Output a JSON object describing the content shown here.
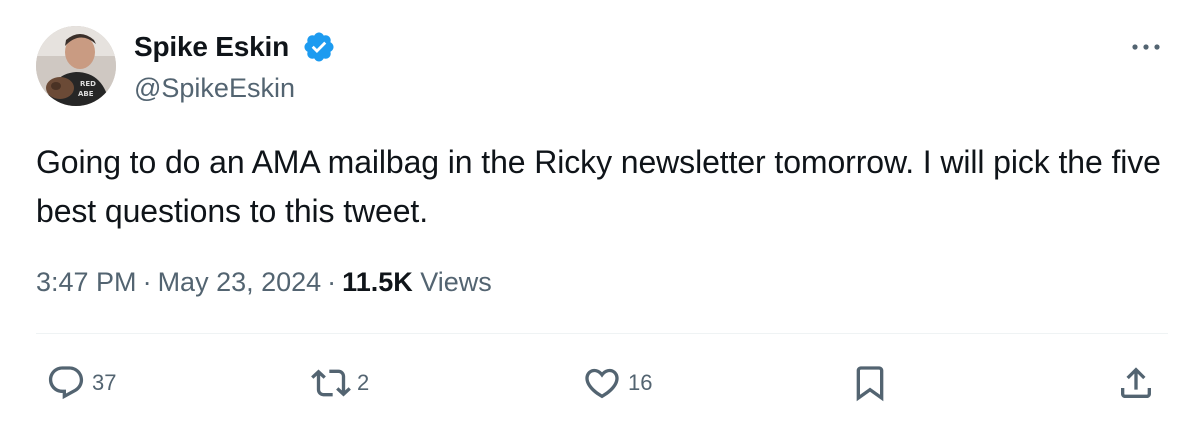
{
  "author": {
    "display_name": "Spike Eskin",
    "handle": "@SpikeEskin",
    "avatar_icon": "profile-photo",
    "verified_icon": "verified-badge-icon",
    "verified_color": "#1d9bf0"
  },
  "tweet": {
    "text": "Going to do an AMA mailbag in the Ricky newsletter tomorrow. I will pick the five best questions to this tweet.",
    "time": "3:47 PM",
    "separator": "·",
    "date": "May 23, 2024",
    "views_count": "11.5K",
    "views_label": "Views"
  },
  "actions": {
    "reply_count": "37",
    "retweet_count": "2",
    "like_count": "16"
  },
  "colors": {
    "text_primary": "#0f1419",
    "text_secondary": "#536471",
    "divider": "#eff3f4"
  }
}
